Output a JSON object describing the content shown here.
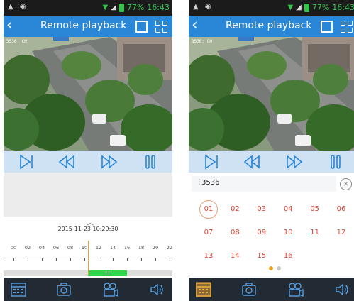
{
  "status_bar": {
    "battery": "77%",
    "time": "16:43"
  },
  "header": {
    "title": "Remote playback"
  },
  "video": {
    "osd_label": "3536: CH"
  },
  "left_panel": {
    "timeline": {
      "datetime": "2015-11-23 10:29:30",
      "hours": [
        "00",
        "02",
        "04",
        "06",
        "08",
        "10",
        "12",
        "14",
        "16",
        "18",
        "20",
        "22"
      ],
      "cursor_hour": 10.5,
      "recording_ranges": [
        [
          10.5,
          16.0
        ]
      ]
    }
  },
  "right_panel": {
    "channel": "3536",
    "days": [
      "01",
      "02",
      "03",
      "04",
      "05",
      "06",
      "07",
      "08",
      "09",
      "10",
      "11",
      "12",
      "13",
      "14",
      "15",
      "16"
    ],
    "selected_day": "01",
    "page_count": 2,
    "active_page": 0
  },
  "colors": {
    "title_bar": "#2a86d6",
    "controls_strip": "#cfe2f4",
    "control_icon": "#2a86d6",
    "bottom_bar": "#222a33",
    "recording": "#35d24c",
    "cursor": "#f0a020",
    "day_text": "#d8402e",
    "selected_ring": "#e8a070",
    "pager_active": "#f0a020",
    "pager_inactive": "#c8c8c8"
  },
  "icons": {
    "controls": [
      "step-forward-icon",
      "rewind-icon",
      "fast-forward-icon",
      "pause-icon"
    ],
    "bottom": [
      "date-picker-icon",
      "snapshot-icon",
      "record-icon",
      "audio-icon"
    ]
  }
}
